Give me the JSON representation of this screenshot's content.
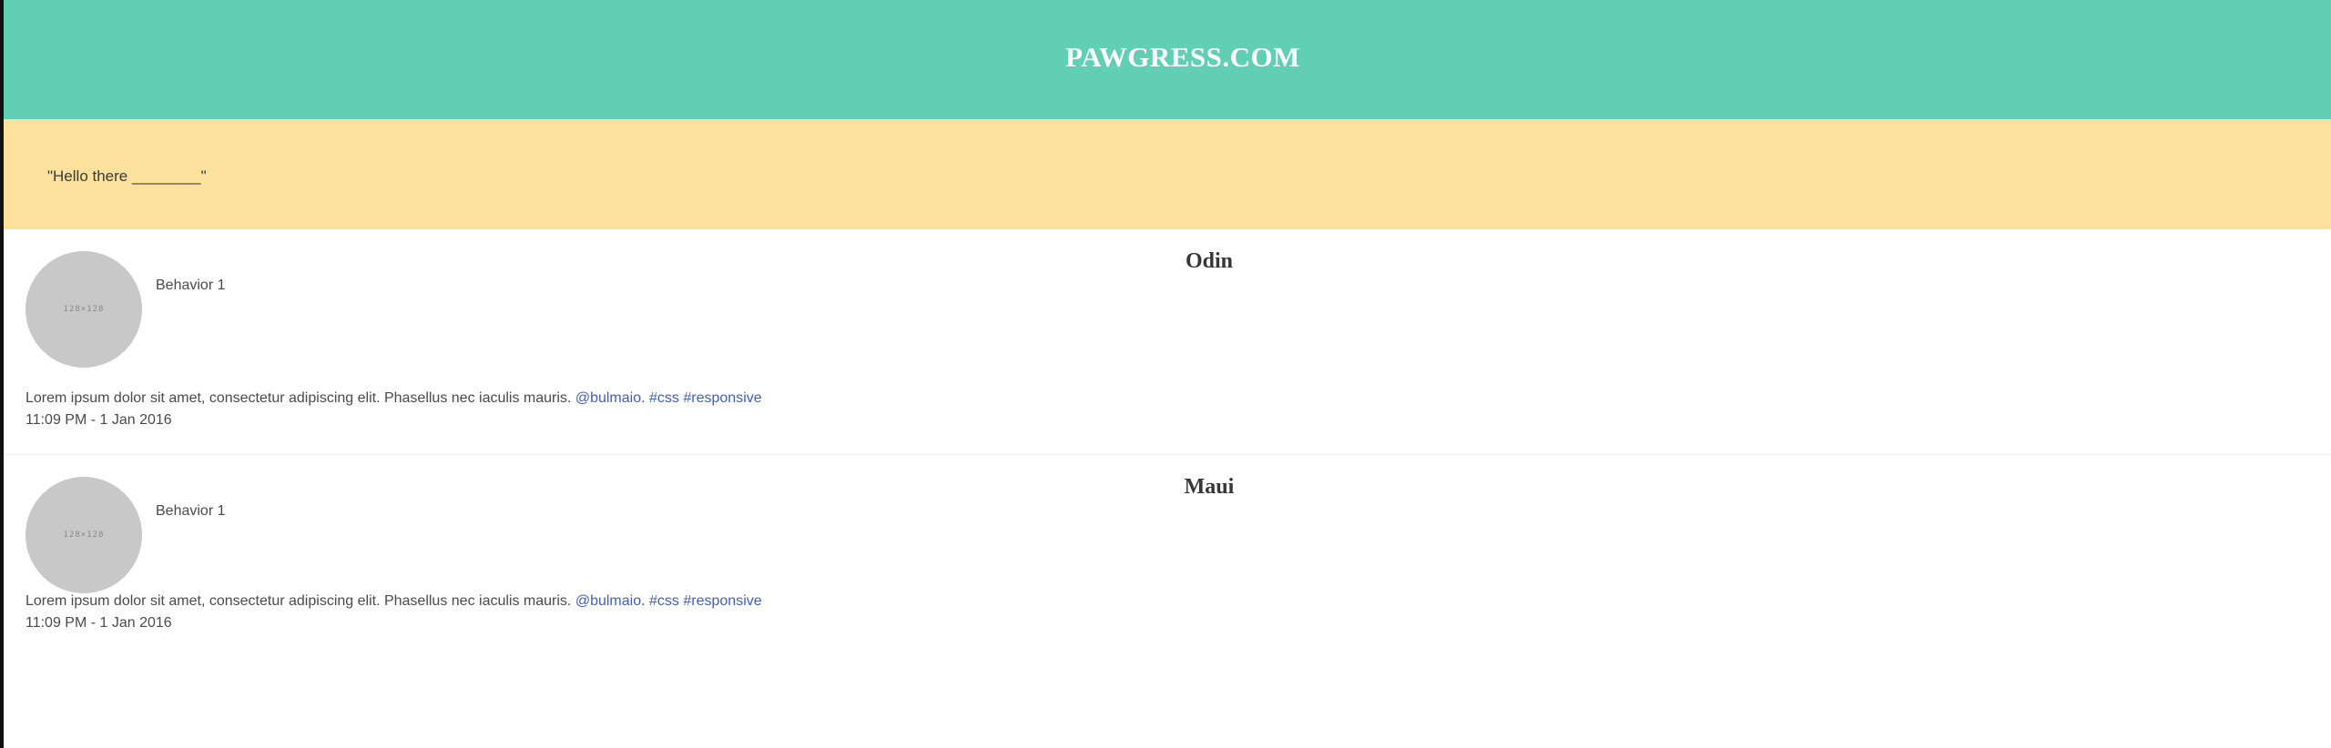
{
  "header": {
    "title": "PAWGRESS.COM"
  },
  "greeting": {
    "text": "\"Hello there ________\""
  },
  "pets": [
    {
      "name": "Odin",
      "avatar_label": "128×128",
      "behavior": "Behavior 1",
      "description": "Lorem ipsum dolor sit amet, consectetur adipiscing elit. Phasellus nec iaculis mauris.",
      "mention": "@bulmaio",
      "separator": ".",
      "tag_css": "#css",
      "tag_responsive": "#responsive",
      "timestamp": "11:09 PM - 1 Jan 2016"
    },
    {
      "name": "Maui",
      "avatar_label": "128×128",
      "behavior": "Behavior 1",
      "description": "Lorem ipsum dolor sit amet, consectetur adipiscing elit. Phasellus nec iaculis mauris.",
      "mention": "@bulmaio",
      "separator": ".",
      "tag_css": "#css",
      "tag_responsive": "#responsive",
      "timestamp": "11:09 PM - 1 Jan 2016"
    }
  ],
  "colors": {
    "header_bg": "#60cfb3",
    "greeting_bg": "#fbe19b",
    "link": "#3e5fc4",
    "avatar_placeholder": "#c8c8c8"
  }
}
